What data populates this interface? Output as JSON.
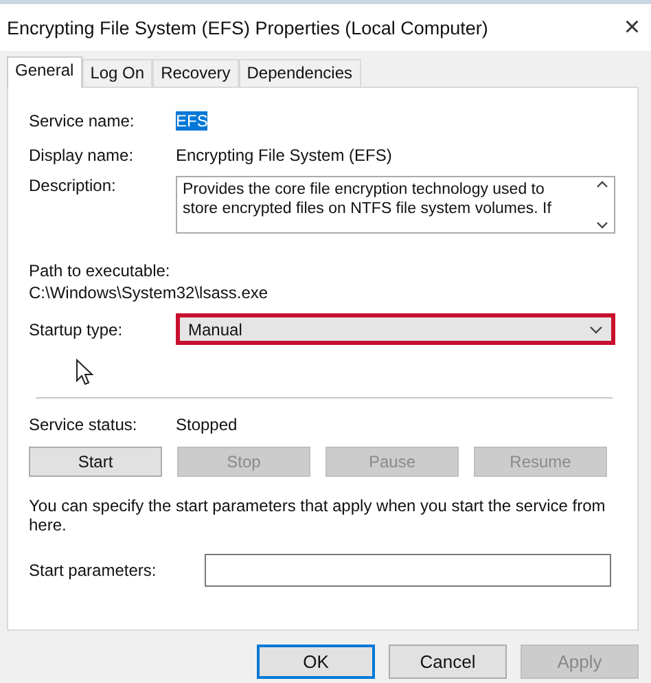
{
  "window": {
    "title": "Encrypting File System (EFS) Properties (Local Computer)",
    "close": "×"
  },
  "tabs": [
    {
      "label": "General",
      "selected": true
    },
    {
      "label": "Log On",
      "selected": false
    },
    {
      "label": "Recovery",
      "selected": false
    },
    {
      "label": "Dependencies",
      "selected": false
    }
  ],
  "service_name": {
    "label": "Service name:",
    "value": "EFS",
    "selected": true
  },
  "display_name": {
    "label": "Display name:",
    "value": "Encrypting File System (EFS)"
  },
  "description": {
    "label": "Description:",
    "value": "Provides the core file encryption technology used to store encrypted files on NTFS file system volumes. If"
  },
  "path": {
    "label": "Path to executable:",
    "value": "C:\\Windows\\System32\\lsass.exe"
  },
  "startup_type": {
    "label": "Startup type:",
    "value": "Manual",
    "highlighted": true
  },
  "service_status": {
    "label": "Service status:",
    "value": "Stopped"
  },
  "service_buttons": [
    {
      "label": "Start",
      "disabled": false
    },
    {
      "label": "Stop",
      "disabled": true
    },
    {
      "label": "Pause",
      "disabled": true
    },
    {
      "label": "Resume",
      "disabled": true
    }
  ],
  "hint": "You can specify the start parameters that apply when you start the service from here.",
  "start_parameters": {
    "label": "Start parameters:"
  },
  "footer_buttons": [
    {
      "label": "OK",
      "default": true,
      "disabled": false
    },
    {
      "label": "Cancel",
      "default": false,
      "disabled": false
    },
    {
      "label": "Apply",
      "default": false,
      "disabled": true
    }
  ]
}
